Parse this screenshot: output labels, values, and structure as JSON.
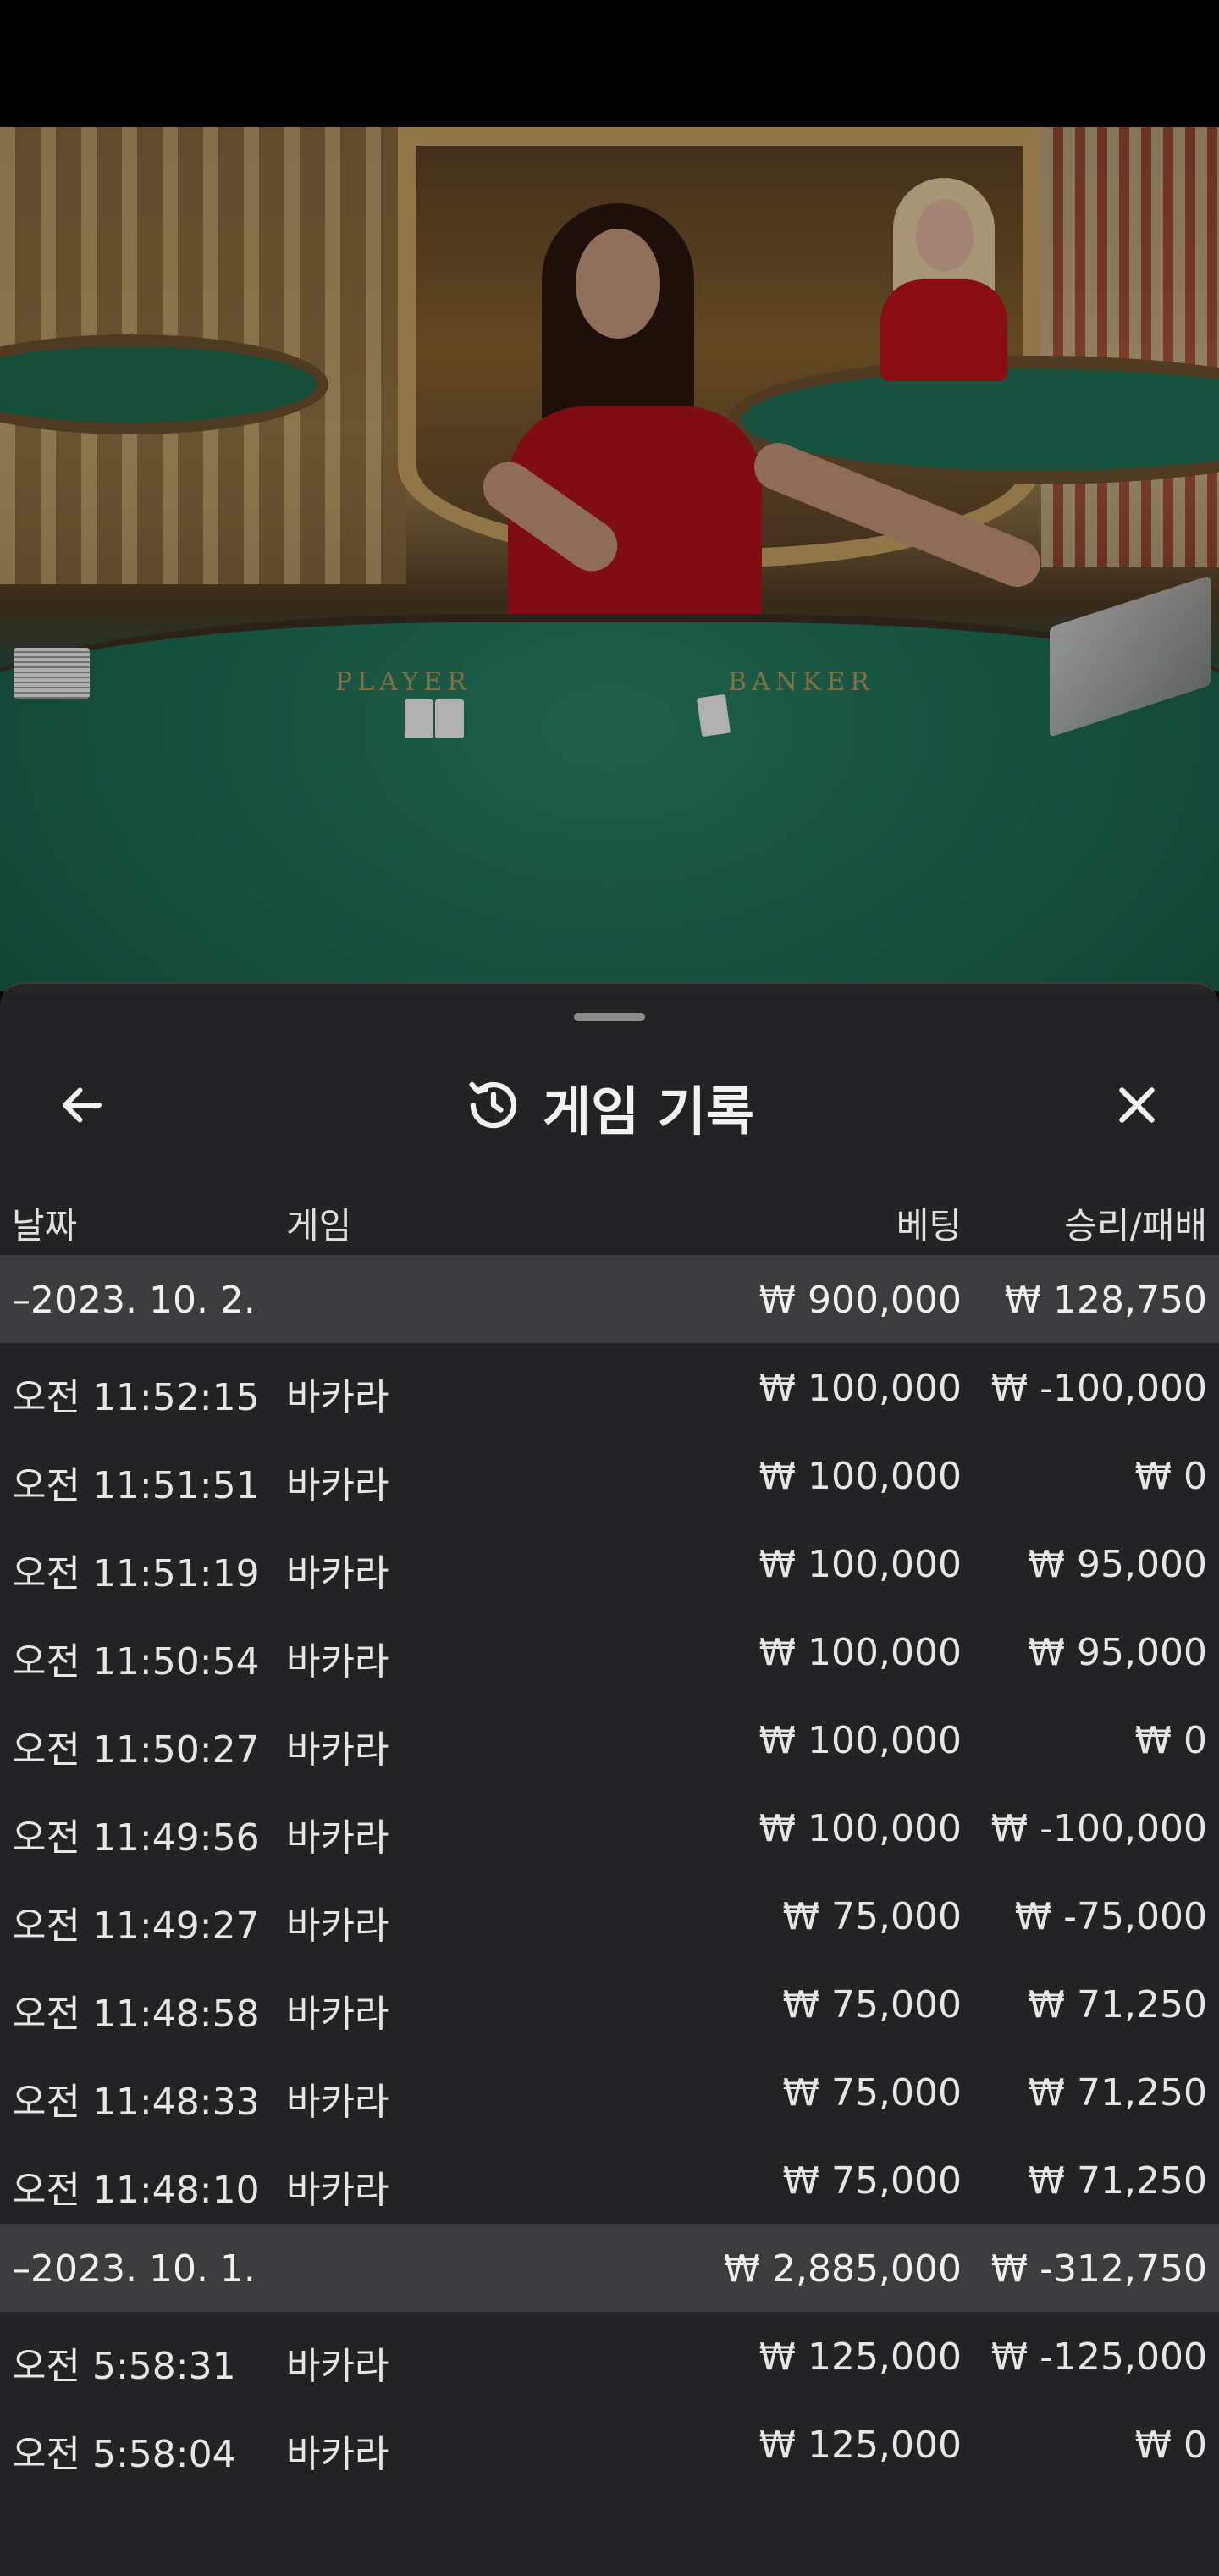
{
  "sheet": {
    "title": "게임 기록",
    "columns": {
      "date": "날짜",
      "game": "게임",
      "bet": "베팅",
      "result": "승리/패배"
    },
    "groups": [
      {
        "date": "–2023. 10. 2.",
        "bet_total": "₩ 900,000",
        "result_total": "₩ 128,750",
        "rows": [
          {
            "time": "오전 11:52:15",
            "game": "바카라",
            "bet": "₩ 100,000",
            "result": "₩ -100,000"
          },
          {
            "time": "오전 11:51:51",
            "game": "바카라",
            "bet": "₩ 100,000",
            "result": "₩ 0"
          },
          {
            "time": "오전 11:51:19",
            "game": "바카라",
            "bet": "₩ 100,000",
            "result": "₩ 95,000"
          },
          {
            "time": "오전 11:50:54",
            "game": "바카라",
            "bet": "₩ 100,000",
            "result": "₩ 95,000"
          },
          {
            "time": "오전 11:50:27",
            "game": "바카라",
            "bet": "₩ 100,000",
            "result": "₩ 0"
          },
          {
            "time": "오전 11:49:56",
            "game": "바카라",
            "bet": "₩ 100,000",
            "result": "₩ -100,000"
          },
          {
            "time": "오전 11:49:27",
            "game": "바카라",
            "bet": "₩ 75,000",
            "result": "₩ -75,000"
          },
          {
            "time": "오전 11:48:58",
            "game": "바카라",
            "bet": "₩ 75,000",
            "result": "₩ 71,250"
          },
          {
            "time": "오전 11:48:33",
            "game": "바카라",
            "bet": "₩ 75,000",
            "result": "₩ 71,250"
          },
          {
            "time": "오전 11:48:10",
            "game": "바카라",
            "bet": "₩ 75,000",
            "result": "₩ 71,250"
          }
        ]
      },
      {
        "date": "–2023. 10. 1.",
        "bet_total": "₩ 2,885,000",
        "result_total": "₩ -312,750",
        "rows": [
          {
            "time": "오전 5:58:31",
            "game": "바카라",
            "bet": "₩ 125,000",
            "result": "₩ -125,000"
          },
          {
            "time": "오전 5:58:04",
            "game": "바카라",
            "bet": "₩ 125,000",
            "result": "₩ 0"
          }
        ]
      }
    ]
  },
  "video": {
    "table_labels": [
      "PLAYER",
      "BANKER"
    ]
  },
  "icons": {
    "back": "arrow-left-icon",
    "history": "history-icon",
    "close": "close-icon"
  },
  "colors": {
    "sheet_bg": "#242426",
    "group_bg": "#3c3c3e",
    "table_green": "#1c6b52",
    "dealer_red": "#b2131c"
  }
}
